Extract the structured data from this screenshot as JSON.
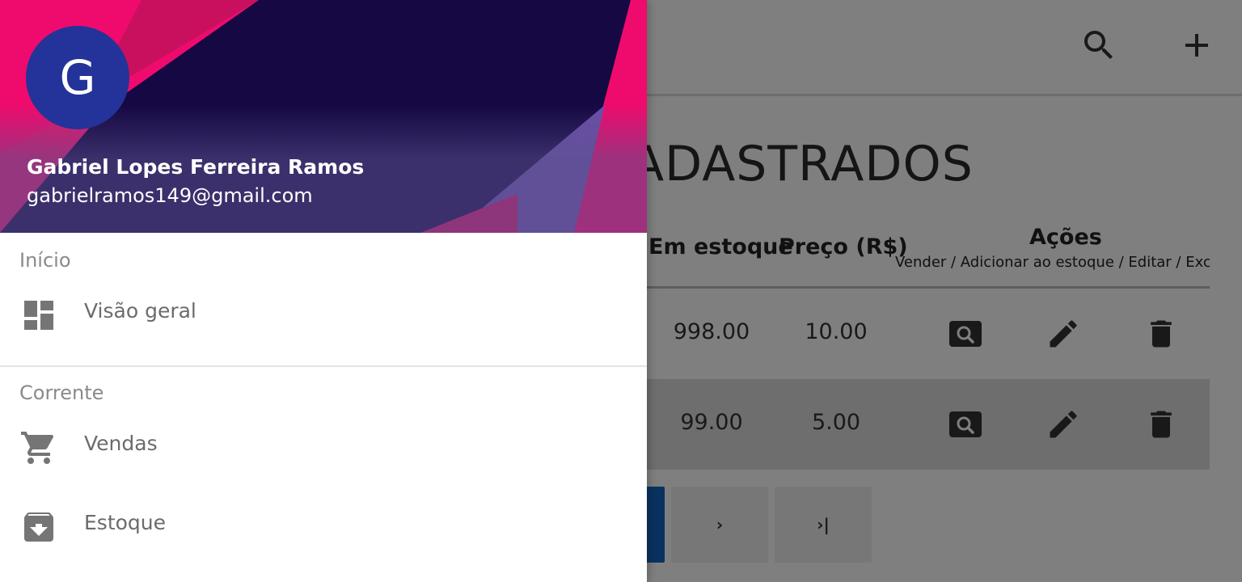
{
  "drawer": {
    "header": {
      "avatar_initial": "G",
      "user_name": "Gabriel Lopes Ferreira Ramos",
      "user_email": "gabrielramos149@gmail.com"
    },
    "sections": {
      "inicio": "Início",
      "corrente": "Corrente"
    },
    "items": {
      "visao_geral": {
        "label": "Visão geral",
        "icon": "dashboard-icon"
      },
      "vendas": {
        "label": "Vendas",
        "icon": "shopping-cart-icon"
      },
      "estoque": {
        "label": "Estoque",
        "icon": "archive-icon"
      }
    }
  },
  "background_page": {
    "toolbar": {
      "search_icon": "search-icon",
      "add_icon": "add-icon"
    },
    "heading": "ADASTRADOS",
    "table": {
      "headers": {
        "stock": "Em estoque",
        "price": "Preço (R$)",
        "actions": "Ações",
        "actions_sub": "Vender / Adicionar ao estoque / Editar / Excluir"
      },
      "rows": [
        {
          "stock": "998.00",
          "price": "10.00"
        },
        {
          "stock": "99.00",
          "price": "5.00"
        }
      ]
    },
    "pagination": {
      "next": "›",
      "last": "›|"
    }
  },
  "colors": {
    "scrim": "rgba(0,0,0,0.5)",
    "avatar": "#233399",
    "header_dark": "#150843",
    "header_pink": "#ee0b6d",
    "pager_active": "#1565c0"
  }
}
